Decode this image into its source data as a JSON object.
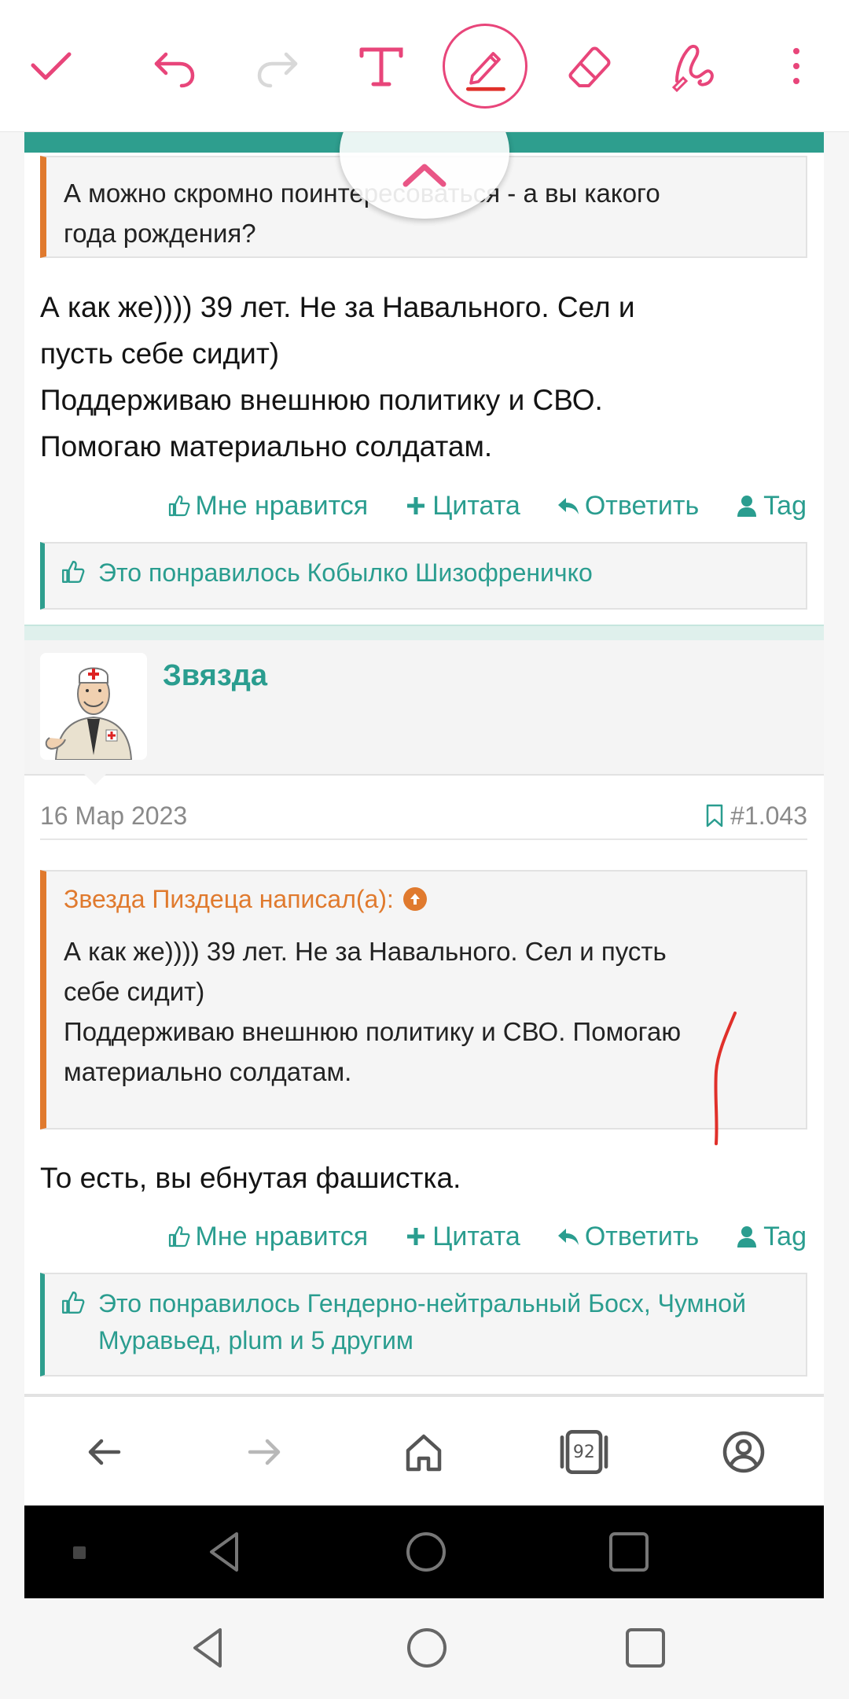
{
  "toolbar": {
    "tools": [
      {
        "name": "done",
        "icon": "check-icon"
      },
      {
        "name": "undo",
        "icon": "undo-icon"
      },
      {
        "name": "redo",
        "icon": "redo-icon"
      },
      {
        "name": "text",
        "icon": "text-tool-icon"
      },
      {
        "name": "pen",
        "icon": "pen-icon",
        "active": true
      },
      {
        "name": "eraser",
        "icon": "eraser-icon"
      },
      {
        "name": "signature",
        "icon": "signature-icon"
      },
      {
        "name": "more",
        "icon": "more-vertical-icon"
      }
    ],
    "accent": "#e8457a"
  },
  "post1": {
    "quote_text": "А можно скромно поинтересоваться - а вы какого\nгода рождения?",
    "text": "А как же)))) 39 лет. Не за Навального. Сел и\nпусть себе сидит)\nПоддерживаю внешнюю политику и СВО.\nПомогаю материально солдатам.",
    "actions": {
      "like": "Мне нравится",
      "quote": "Цитата",
      "reply": "Ответить",
      "tag": "Tag"
    },
    "likes": "Это понравилось Кобылко Шизофреничко"
  },
  "post2": {
    "username": "Звязда",
    "date": "16 Мар 2023",
    "number": "#1.043",
    "quote_author": "Звезда Пиздеца написал(а):",
    "quote_text": "А как же)))) 39 лет. Не за Навального. Сел и пусть\nсебе сидит)\nПоддерживаю внешнюю политику и СВО. Помогаю\nматериально солдатам.",
    "text": "То есть, вы ебнутая фашистка.",
    "actions": {
      "like": "Мне нравится",
      "quote": "Цитата",
      "reply": "Ответить",
      "tag": "Tag"
    },
    "likes": "Это понравилось Гендерно-нейтральный Босх, Чумной Муравьед, plum и 5 другим"
  },
  "browser_nav": {
    "tab_count": "92"
  },
  "colors": {
    "teal": "#2a9d8f",
    "orange": "#e07a2e",
    "pink": "#e8457a",
    "annotation_red": "#e0302a"
  }
}
